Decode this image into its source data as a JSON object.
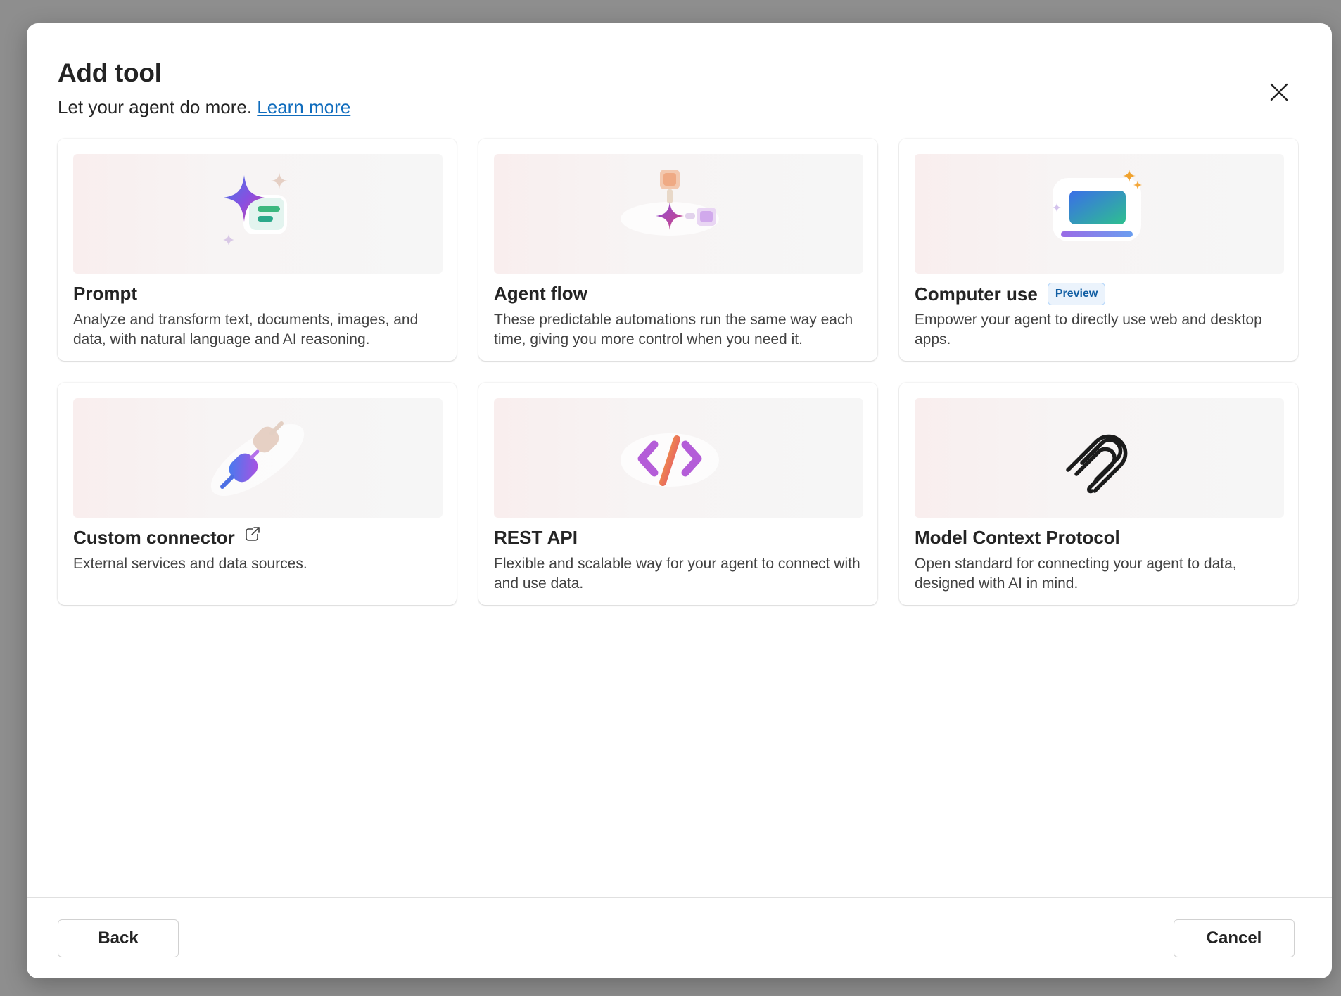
{
  "dialog": {
    "title": "Add tool",
    "subtitle": "Let your agent do more.",
    "learn_more": "Learn more",
    "close_icon": "close-icon"
  },
  "cards": [
    {
      "title": "Prompt",
      "description": "Analyze and transform text, documents, images, and data, with natural language and AI reasoning.",
      "icon": "sparkle-prompt-icon"
    },
    {
      "title": "Agent flow",
      "description": "These predictable automations run the same way each time, giving you more control when you need it.",
      "icon": "flow-icon"
    },
    {
      "title": "Computer use",
      "badge": "Preview",
      "description": "Empower your agent to directly use web and desktop apps.",
      "icon": "computer-icon"
    },
    {
      "title": "Custom connector",
      "description": "External services and data sources.",
      "icon": "plug-icon",
      "external_icon": "open-external-icon"
    },
    {
      "title": "REST API",
      "description": "Flexible and scalable way for your agent to connect with and use data.",
      "icon": "code-icon"
    },
    {
      "title": "Model Context Protocol",
      "description": "Open standard for connecting your agent to data, designed with AI in mind.",
      "icon": "mcp-icon"
    }
  ],
  "footer": {
    "back": "Back",
    "cancel": "Cancel"
  }
}
